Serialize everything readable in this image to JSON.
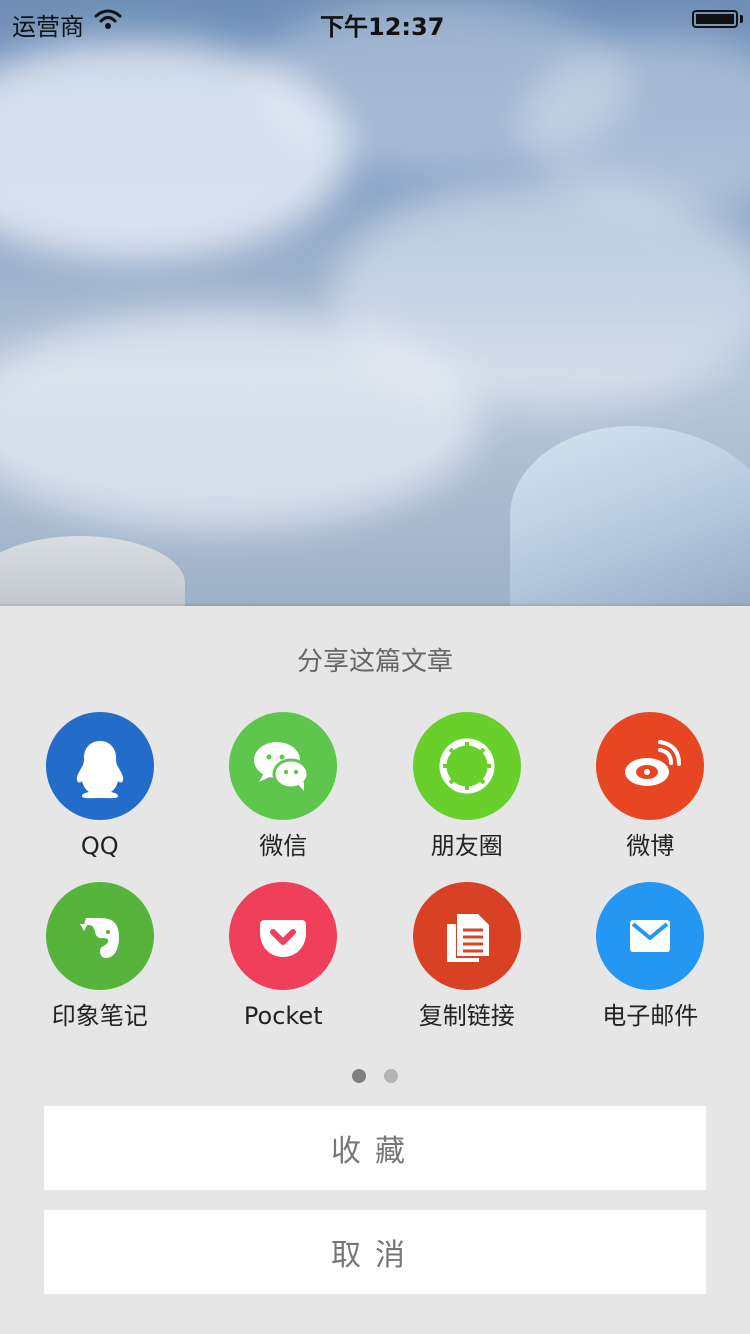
{
  "status_bar": {
    "carrier": "运营商",
    "time": "下午12:37",
    "battery_level": 1.0
  },
  "share_sheet": {
    "title": "分享这篇文章",
    "items": [
      {
        "label": "QQ",
        "icon": "qq-icon",
        "color": "#236cc9"
      },
      {
        "label": "微信",
        "icon": "wechat-icon",
        "color": "#5ec64c"
      },
      {
        "label": "朋友圈",
        "icon": "moments-icon",
        "color": "#69cf2a"
      },
      {
        "label": "微博",
        "icon": "weibo-icon",
        "color": "#e84523"
      },
      {
        "label": "印象笔记",
        "icon": "evernote-icon",
        "color": "#56b43d"
      },
      {
        "label": "Pocket",
        "icon": "pocket-icon",
        "color": "#ef3f5b"
      },
      {
        "label": "复制链接",
        "icon": "copy-link-icon",
        "color": "#d84123"
      },
      {
        "label": "电子邮件",
        "icon": "mail-icon",
        "color": "#2397f2"
      }
    ],
    "page_indicator": {
      "current": 1,
      "total": 2
    },
    "favorite_label": "收藏",
    "cancel_label": "取消"
  },
  "colors": {
    "sheet_background": "#e6e6e6",
    "button_background": "#ffffff",
    "active_dot": "#808080",
    "inactive_dot": "#b3b3b3"
  }
}
